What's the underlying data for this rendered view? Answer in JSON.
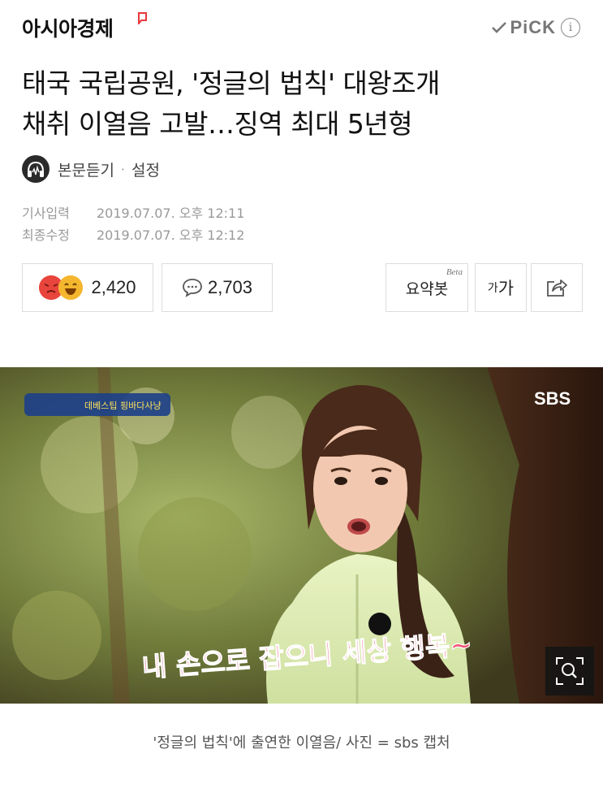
{
  "header": {
    "brand": "아시아경제",
    "pick_label": "PiCK",
    "info_label": "i"
  },
  "article": {
    "title_line1": "태국 국립공원, '정글의 법칙' 대왕조개",
    "title_line2": "채취 이열음 고발…징역 최대 5년형",
    "listen_label": "본문듣기",
    "separator": "·",
    "settings_label": "설정",
    "published_key": "기사입력",
    "published_value": "2019.07.07. 오후 12:11",
    "modified_key": "최종수정",
    "modified_value": "2019.07.07. 오후 12:12"
  },
  "actions": {
    "reaction_count": "2,420",
    "comment_count": "2,703",
    "summary_label": "요약봇",
    "summary_badge": "Beta",
    "font_small": "가",
    "font_big": "가"
  },
  "photo": {
    "broadcaster": "SBS",
    "program_badge": "데베스팁 핑바다사냥",
    "subtitle": "내 손으로 잡으니 세상 행복~",
    "caption": "'정글의 법칙'에 출연한 이열음/ 사진 = sbs 캡처"
  },
  "colors": {
    "brand_mark": "#e8383d",
    "angry": "#e8453c",
    "happy": "#f5b62f",
    "subtitle_pink": "#f2506f"
  },
  "icons": [
    "check-icon",
    "info-icon",
    "headphone-icon",
    "comment-icon",
    "share-icon",
    "zoom-icon"
  ]
}
